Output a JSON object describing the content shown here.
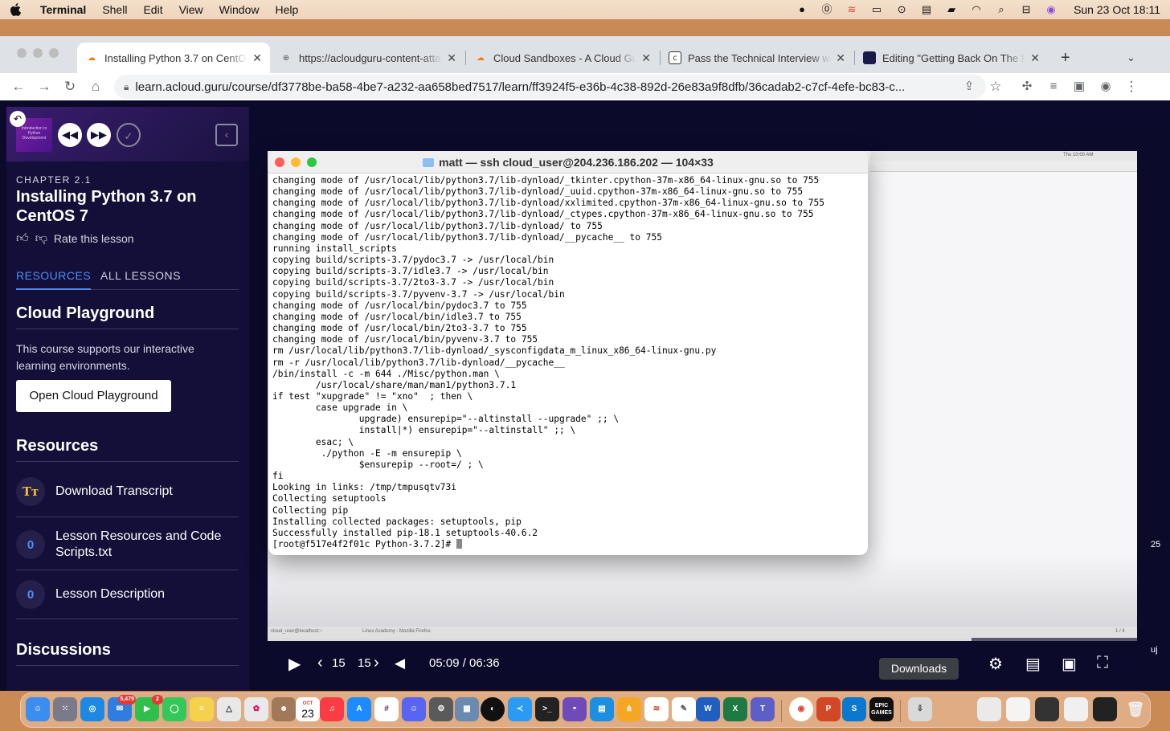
{
  "menubar": {
    "app_name": "Terminal",
    "items": [
      "Shell",
      "Edit",
      "View",
      "Window",
      "Help"
    ],
    "clock": "Sun 23 Oct  18:11",
    "status_icons": [
      "bitwarden-icon",
      "1password-icon",
      "fan-icon",
      "screen-mirror-icon",
      "play-icon",
      "keyboard-icon",
      "battery-icon",
      "wifi-icon",
      "search-icon",
      "control-center-icon",
      "siri-icon"
    ]
  },
  "browser": {
    "tabs": [
      {
        "title": "Installing Python 3.7 on CentOS 7",
        "favicon": "cloud-guru-icon",
        "active": true
      },
      {
        "title": "https://acloudguru-content-attachments",
        "favicon": "globe-icon",
        "active": false
      },
      {
        "title": "Cloud Sandboxes - A Cloud Guru",
        "favicon": "cloud-guru-icon",
        "active": false
      },
      {
        "title": "Pass the Technical Interview with",
        "favicon": "codecademy-icon",
        "active": false
      },
      {
        "title": "Editing \"Getting Back On The Horse\"",
        "favicon": "editor-icon",
        "active": false
      }
    ],
    "new_tab": "+",
    "url": "learn.acloud.guru/course/df3778be-ba58-4be7-a232-aa658bed7517/learn/ff3924f5-e36b-4c38-892d-26e83a9f8dfb/36cadab2-c7cf-4efe-bc83-c..."
  },
  "sidebar": {
    "chapter": "CHAPTER 2.1",
    "lesson_title": "Installing Python 3.7 on CentOS 7",
    "thumb_text": "Introduction to Python Development",
    "rate_label": "Rate this lesson",
    "tabs": {
      "resources": "RESOURCES",
      "all_lessons": "ALL LESSONS"
    },
    "playground": {
      "heading": "Cloud Playground",
      "description": "This course supports our interactive learning environments.",
      "button": "Open Cloud Playground"
    },
    "resources": {
      "heading": "Resources",
      "items": [
        {
          "label": "Download Transcript",
          "icon": "transcript-icon",
          "glyph": "Tт"
        },
        {
          "label": "Lesson Resources and Code Scripts.txt",
          "icon": "paperclip-icon",
          "glyph": "0"
        },
        {
          "label": "Lesson Description",
          "icon": "paperclip-icon",
          "glyph": "0"
        }
      ]
    },
    "discussions_heading": "Discussions"
  },
  "terminal": {
    "title": "matt — ssh cloud_user@204.236.186.202 — 104×33",
    "lines": [
      "changing mode of /usr/local/lib/python3.7/lib-dynload/_tkinter.cpython-37m-x86_64-linux-gnu.so to 755",
      "changing mode of /usr/local/lib/python3.7/lib-dynload/_uuid.cpython-37m-x86_64-linux-gnu.so to 755",
      "changing mode of /usr/local/lib/python3.7/lib-dynload/xxlimited.cpython-37m-x86_64-linux-gnu.so to 755",
      "changing mode of /usr/local/lib/python3.7/lib-dynload/_ctypes.cpython-37m-x86_64-linux-gnu.so to 755",
      "changing mode of /usr/local/lib/python3.7/lib-dynload/ to 755",
      "changing mode of /usr/local/lib/python3.7/lib-dynload/__pycache__ to 755",
      "running install_scripts",
      "copying build/scripts-3.7/pydoc3.7 -> /usr/local/bin",
      "copying build/scripts-3.7/idle3.7 -> /usr/local/bin",
      "copying build/scripts-3.7/2to3-3.7 -> /usr/local/bin",
      "copying build/scripts-3.7/pyvenv-3.7 -> /usr/local/bin",
      "changing mode of /usr/local/bin/pydoc3.7 to 755",
      "changing mode of /usr/local/bin/idle3.7 to 755",
      "changing mode of /usr/local/bin/2to3-3.7 to 755",
      "changing mode of /usr/local/bin/pyvenv-3.7 to 755",
      "rm /usr/local/lib/python3.7/lib-dynload/_sysconfigdata_m_linux_x86_64-linux-gnu.py",
      "rm -r /usr/local/lib/python3.7/lib-dynload/__pycache__",
      "/bin/install -c -m 644 ./Misc/python.man \\",
      "        /usr/local/share/man/man1/python3.7.1",
      "if test \"xupgrade\" != \"xno\"  ; then \\",
      "        case upgrade in \\",
      "                upgrade) ensurepip=\"--altinstall --upgrade\" ;; \\",
      "                install|*) ensurepip=\"--altinstall\" ;; \\",
      "        esac; \\",
      "         ./python -E -m ensurepip \\",
      "                $ensurepip --root=/ ; \\",
      "fi",
      "Looking in links: /tmp/tmpusqtv73i",
      "Collecting setuptools",
      "Collecting pip",
      "Installing collected packages: setuptools, pip",
      "Successfully installed pip-18.1 setuptools-40.6.2"
    ],
    "prompt": "[root@f517e4f2f01c Python-3.7.2]# "
  },
  "vm_screen": {
    "clock": "Thu 10:00 AM",
    "taskbar": [
      "cloud_user@localhost:~",
      "Linux Academy - Mozilla Firefox"
    ],
    "page": "1 / 4"
  },
  "player": {
    "skip_back": "15",
    "skip_forward": "15",
    "time": "05:09 / 06:36",
    "progress": 0.81,
    "tooltip": "Downloads"
  },
  "edge_labels": {
    "right_number": "25",
    "right_text": "uj"
  },
  "dock": {
    "calendar_month": "OCT",
    "calendar_day": "23",
    "mail_badge": "5,479",
    "facetime_badge": "2",
    "epic_label": "EPIC GAMES"
  }
}
